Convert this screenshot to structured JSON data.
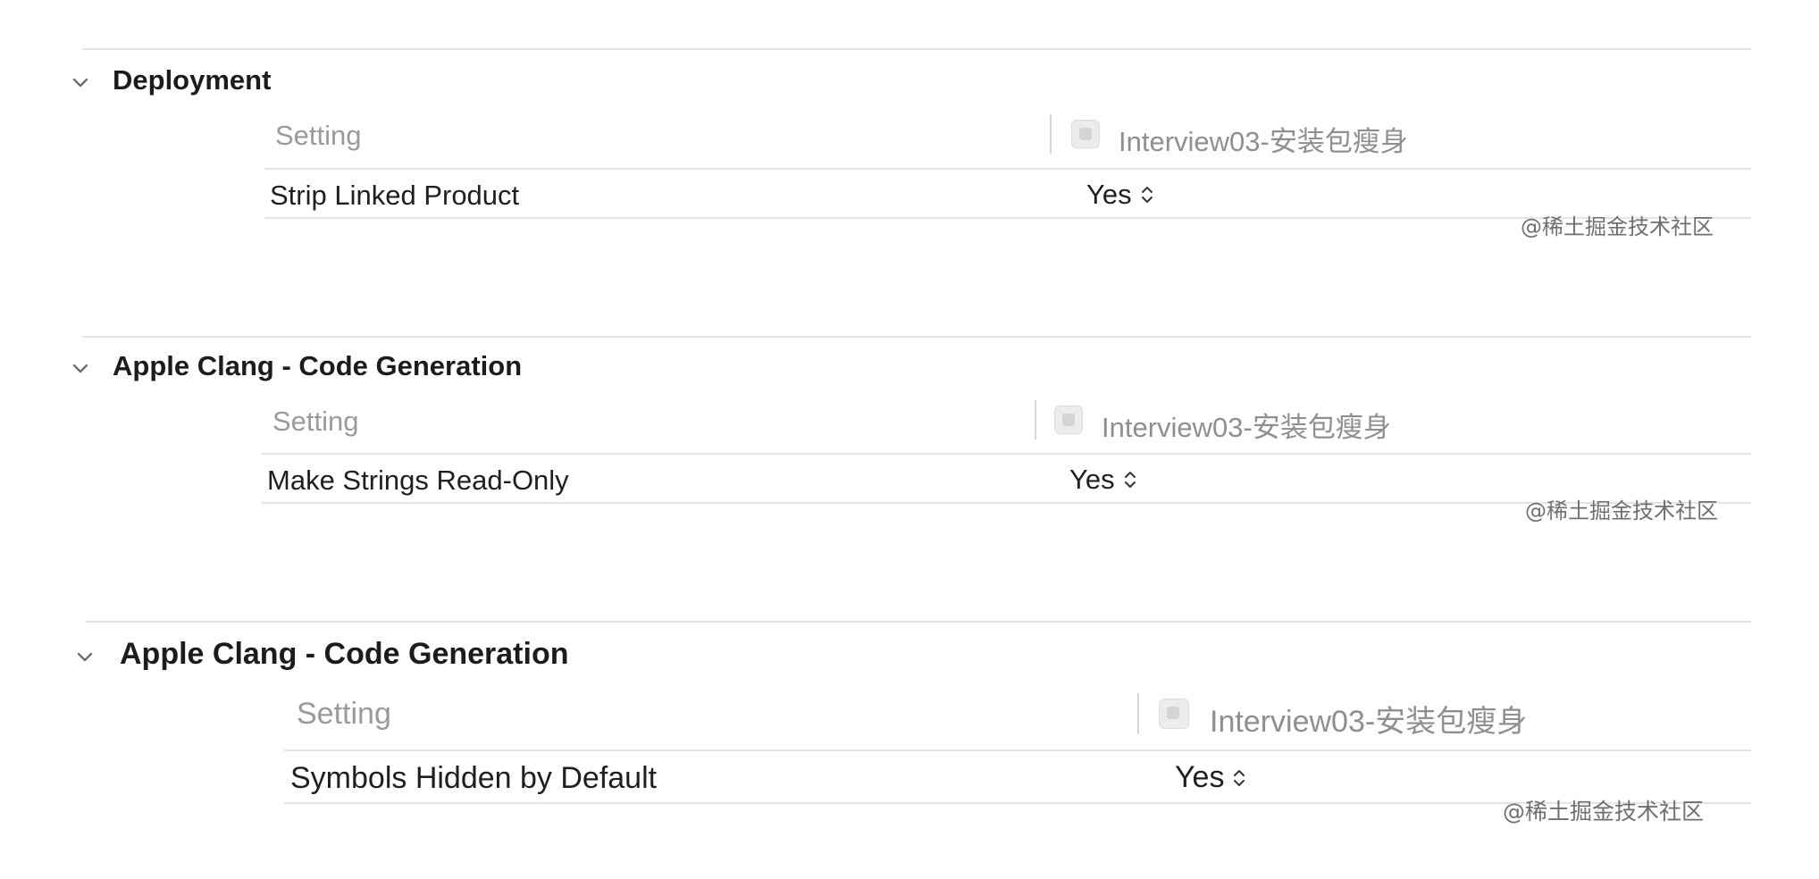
{
  "sections": [
    {
      "title": "Deployment",
      "header_setting": "Setting",
      "header_target": "Interview03-安装包瘦身",
      "setting_name": "Strip Linked Product",
      "setting_value": "Yes",
      "watermark": "@稀土掘金技术社区"
    },
    {
      "title": "Apple Clang - Code Generation",
      "header_setting": "Setting",
      "header_target": "Interview03-安装包瘦身",
      "setting_name": "Make Strings Read-Only",
      "setting_value": "Yes",
      "watermark": "@稀土掘金技术社区"
    },
    {
      "title": "Apple Clang - Code Generation",
      "header_setting": "Setting",
      "header_target": "Interview03-安装包瘦身",
      "setting_name": "Symbols Hidden by Default",
      "setting_value": "Yes",
      "watermark": "@稀土掘金技术社区"
    }
  ],
  "icons": {
    "collapse": "chevron-down-icon",
    "target": "target-app-icon",
    "value_popup": "up-down-chevron-icon"
  }
}
